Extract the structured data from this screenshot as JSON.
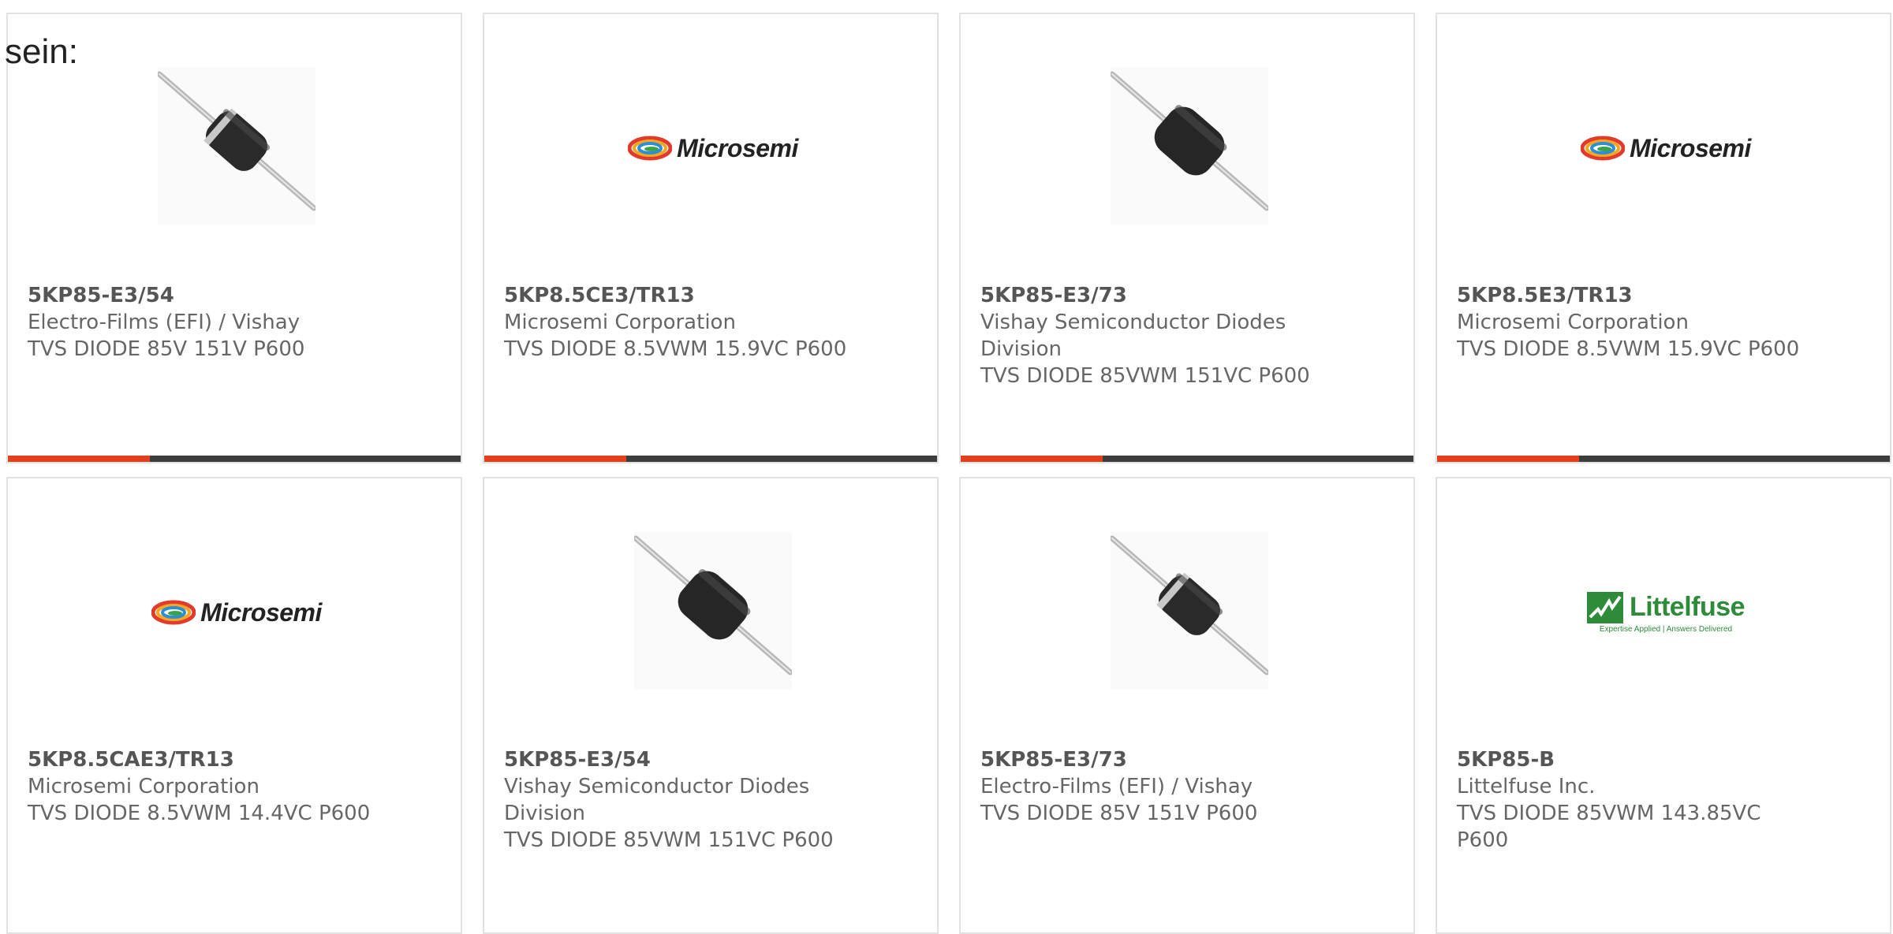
{
  "intro_text": "sein:",
  "products": [
    {
      "part_number": "5KP85-E3/54",
      "manufacturer": "Electro-Films (EFI) / Vishay",
      "description": "TVS DIODE 85V 151V P600",
      "image": "diode-banded"
    },
    {
      "part_number": "5KP8.5CE3/TR13",
      "manufacturer": "Microsemi Corporation",
      "description": "TVS DIODE 8.5VWM 15.9VC P600",
      "image": "microsemi-logo"
    },
    {
      "part_number": "5KP85-E3/73",
      "manufacturer": "Vishay Semiconductor Diodes Division",
      "description": "TVS DIODE 85VWM 151VC P600",
      "image": "diode-plain"
    },
    {
      "part_number": "5KP8.5E3/TR13",
      "manufacturer": "Microsemi Corporation",
      "description": "TVS DIODE 8.5VWM 15.9VC P600",
      "image": "microsemi-logo"
    },
    {
      "part_number": "5KP8.5CAE3/TR13",
      "manufacturer": "Microsemi Corporation",
      "description": "TVS DIODE 8.5VWM 14.4VC P600",
      "image": "microsemi-logo"
    },
    {
      "part_number": "5KP85-E3/54",
      "manufacturer": "Vishay Semiconductor Diodes Division",
      "description": "TVS DIODE 85VWM 151VC P600",
      "image": "diode-plain"
    },
    {
      "part_number": "5KP85-E3/73",
      "manufacturer": "Electro-Films (EFI) / Vishay",
      "description": "TVS DIODE 85V 151V P600",
      "image": "diode-banded"
    },
    {
      "part_number": "5KP85-B",
      "manufacturer": "Littelfuse Inc.",
      "description": "TVS DIODE 85VWM 143.85VC P600",
      "image": "littelfuse-logo"
    }
  ],
  "logos": {
    "microsemi": "Microsemi",
    "littelfuse": "Littelfuse",
    "littelfuse_tagline": "Expertise Applied | Answers Delivered"
  },
  "colors": {
    "accent": "#e2401c",
    "bar": "#3c3c3c",
    "text": "#666666",
    "littelfuse_green": "#2e8b3a"
  }
}
